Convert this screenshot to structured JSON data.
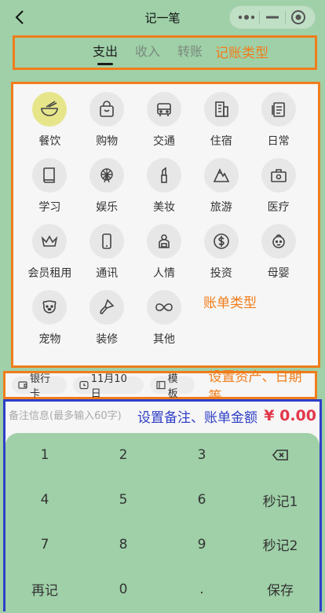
{
  "titlebar": {
    "title": "记一笔",
    "back_icon": "chevron-left-icon",
    "capsule": {
      "more_icon": "more-dots-icon",
      "minimize_icon": "minus-icon",
      "close_icon": "target-circle-icon"
    }
  },
  "tabs": {
    "items": [
      {
        "label": "支出",
        "active": true
      },
      {
        "label": "收入",
        "active": false
      },
      {
        "label": "转账",
        "active": false
      }
    ],
    "annotation": "记账类型"
  },
  "categories": {
    "items": [
      {
        "label": "餐饮",
        "icon": "bowl-icon",
        "active": true
      },
      {
        "label": "购物",
        "icon": "shopping-bag-icon"
      },
      {
        "label": "交通",
        "icon": "bus-icon"
      },
      {
        "label": "住宿",
        "icon": "building-icon"
      },
      {
        "label": "日常",
        "icon": "document-icon"
      },
      {
        "label": "学习",
        "icon": "book-icon"
      },
      {
        "label": "娱乐",
        "icon": "ferris-wheel-icon"
      },
      {
        "label": "美妆",
        "icon": "lipstick-icon"
      },
      {
        "label": "旅游",
        "icon": "mountain-icon"
      },
      {
        "label": "医疗",
        "icon": "medical-kit-icon"
      },
      {
        "label": "会员租用",
        "icon": "crown-icon"
      },
      {
        "label": "通讯",
        "icon": "phone-icon"
      },
      {
        "label": "人情",
        "icon": "gift-person-icon"
      },
      {
        "label": "投资",
        "icon": "dollar-coin-icon"
      },
      {
        "label": "母婴",
        "icon": "baby-icon"
      },
      {
        "label": "宠物",
        "icon": "dog-icon"
      },
      {
        "label": "装修",
        "icon": "paint-brush-icon"
      },
      {
        "label": "其他",
        "icon": "infinity-icon"
      }
    ],
    "annotation": "账单类型"
  },
  "options": {
    "account_label": "银行卡",
    "date_label": "11月10日",
    "template_label": "模板",
    "annotation": "设置资产、日期等"
  },
  "entry": {
    "remark_placeholder": "备注信息(最多输入60字)",
    "annotation": "设置备注、账单金额",
    "amount": "¥ 0.00"
  },
  "keypad": {
    "keys": [
      "1",
      "2",
      "3",
      "backspace",
      "4",
      "5",
      "6",
      "秒记1",
      "7",
      "8",
      "9",
      "秒记2",
      "再记",
      "0",
      ".",
      "保存"
    ]
  },
  "colors": {
    "background": "#9fd0a8",
    "annotation_orange": "#f07d1b",
    "annotation_blue": "#2e3fc7",
    "amount_red": "#e2384b",
    "active_category": "#e6e58a"
  }
}
